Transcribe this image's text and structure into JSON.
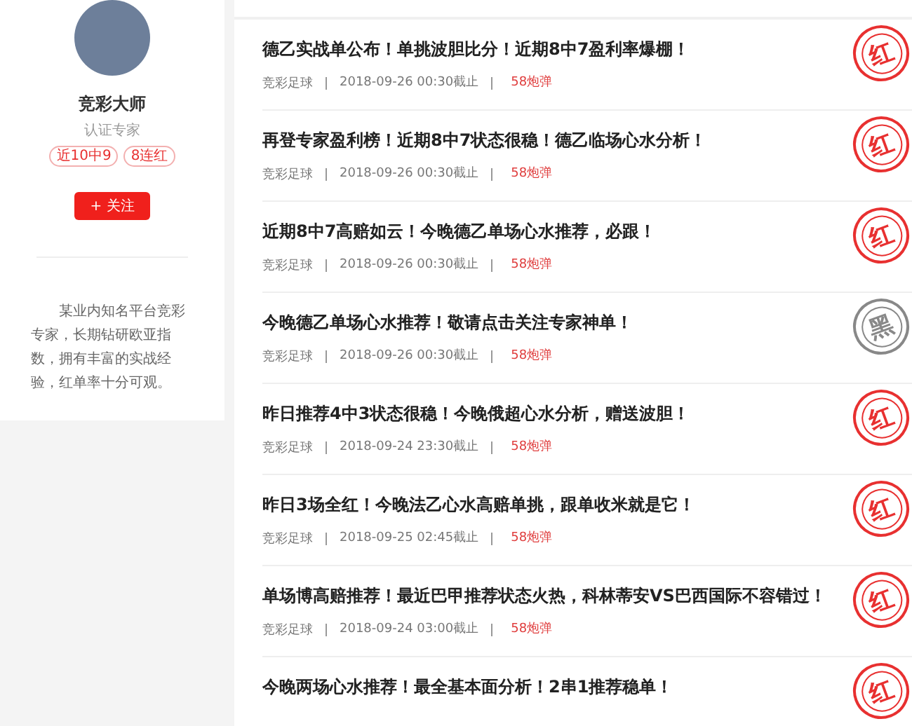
{
  "profile": {
    "name": "竞彩大师",
    "role": "认证专家",
    "tags": [
      "近10中9",
      "8连红"
    ],
    "follow_button": "+ 关注",
    "description": "某业内知名平台竞彩专家，长期钻研欧亚指数，拥有丰富的实战经验，红单率十分可观。"
  },
  "articles": [
    {
      "title": "德乙实战单公布！单挑波胆比分！近期8中7盈利率爆棚！",
      "category": "竞彩足球",
      "deadline": "2018-09-26 00:30截止",
      "price": "58炮弹",
      "result": {
        "kind": "red",
        "label": "红"
      }
    },
    {
      "title": "再登专家盈利榜！近期8中7状态很稳！德乙临场心水分析！",
      "category": "竞彩足球",
      "deadline": "2018-09-26 00:30截止",
      "price": "58炮弹",
      "result": {
        "kind": "red",
        "label": "红"
      }
    },
    {
      "title": "近期8中7高赔如云！今晚德乙单场心水推荐，必跟！",
      "category": "竞彩足球",
      "deadline": "2018-09-26 00:30截止",
      "price": "58炮弹",
      "result": {
        "kind": "red",
        "label": "红"
      }
    },
    {
      "title": "今晚德乙单场心水推荐！敬请点击关注专家神单！",
      "category": "竞彩足球",
      "deadline": "2018-09-26 00:30截止",
      "price": "58炮弹",
      "result": {
        "kind": "black",
        "label": "黑"
      }
    },
    {
      "title": "昨日推荐4中3状态很稳！今晚俄超心水分析，赠送波胆！",
      "category": "竞彩足球",
      "deadline": "2018-09-24 23:30截止",
      "price": "58炮弹",
      "result": {
        "kind": "red",
        "label": "红"
      }
    },
    {
      "title": "昨日3场全红！今晚法乙心水高赔单挑，跟单收米就是它！",
      "category": "竞彩足球",
      "deadline": "2018-09-25 02:45截止",
      "price": "58炮弹",
      "result": {
        "kind": "red",
        "label": "红"
      }
    },
    {
      "title": "单场博高赔推荐！最近巴甲推荐状态火热，科林蒂安VS巴西国际不容错过！",
      "category": "竞彩足球",
      "deadline": "2018-09-24 03:00截止",
      "price": "58炮弹",
      "result": {
        "kind": "red",
        "label": "红"
      }
    },
    {
      "title": "今晚两场心水推荐！最全基本面分析！2串1推荐稳单！",
      "result": {
        "kind": "red",
        "label": "红"
      }
    }
  ]
}
